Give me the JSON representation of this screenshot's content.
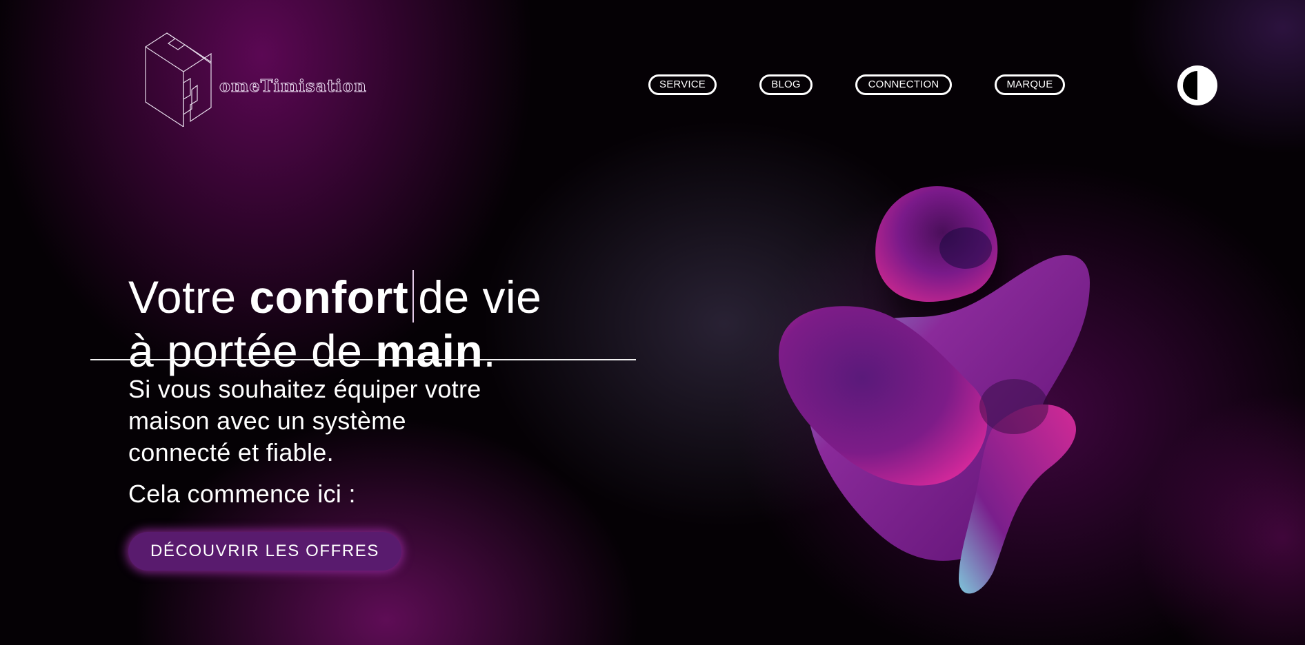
{
  "header": {
    "brand": "omeTimisation",
    "nav": {
      "service": "SERVICE",
      "blog": "BLOG",
      "connection": "CONNECTION",
      "marque": "MARQUE"
    },
    "theme_toggle_icon": "contrast-icon"
  },
  "hero": {
    "headline": {
      "line1_regular_a": "Votre ",
      "line1_bold": "confort",
      "line1_regular_b": "de vie",
      "line2_regular": "à portée de ",
      "line2_bold": "main",
      "line2_end": "."
    },
    "subtitle": [
      "Si vous souhaitez équiper votre",
      "maison avec un système",
      "connecté et fiable."
    ],
    "tagline": "Cela commence ici :",
    "cta_label": "DÉCOUVRIR LES OFFRES"
  },
  "colors": {
    "background": "#050105",
    "accent": "#591b6e",
    "glow": "#8c2896",
    "text": "#ffffff"
  }
}
